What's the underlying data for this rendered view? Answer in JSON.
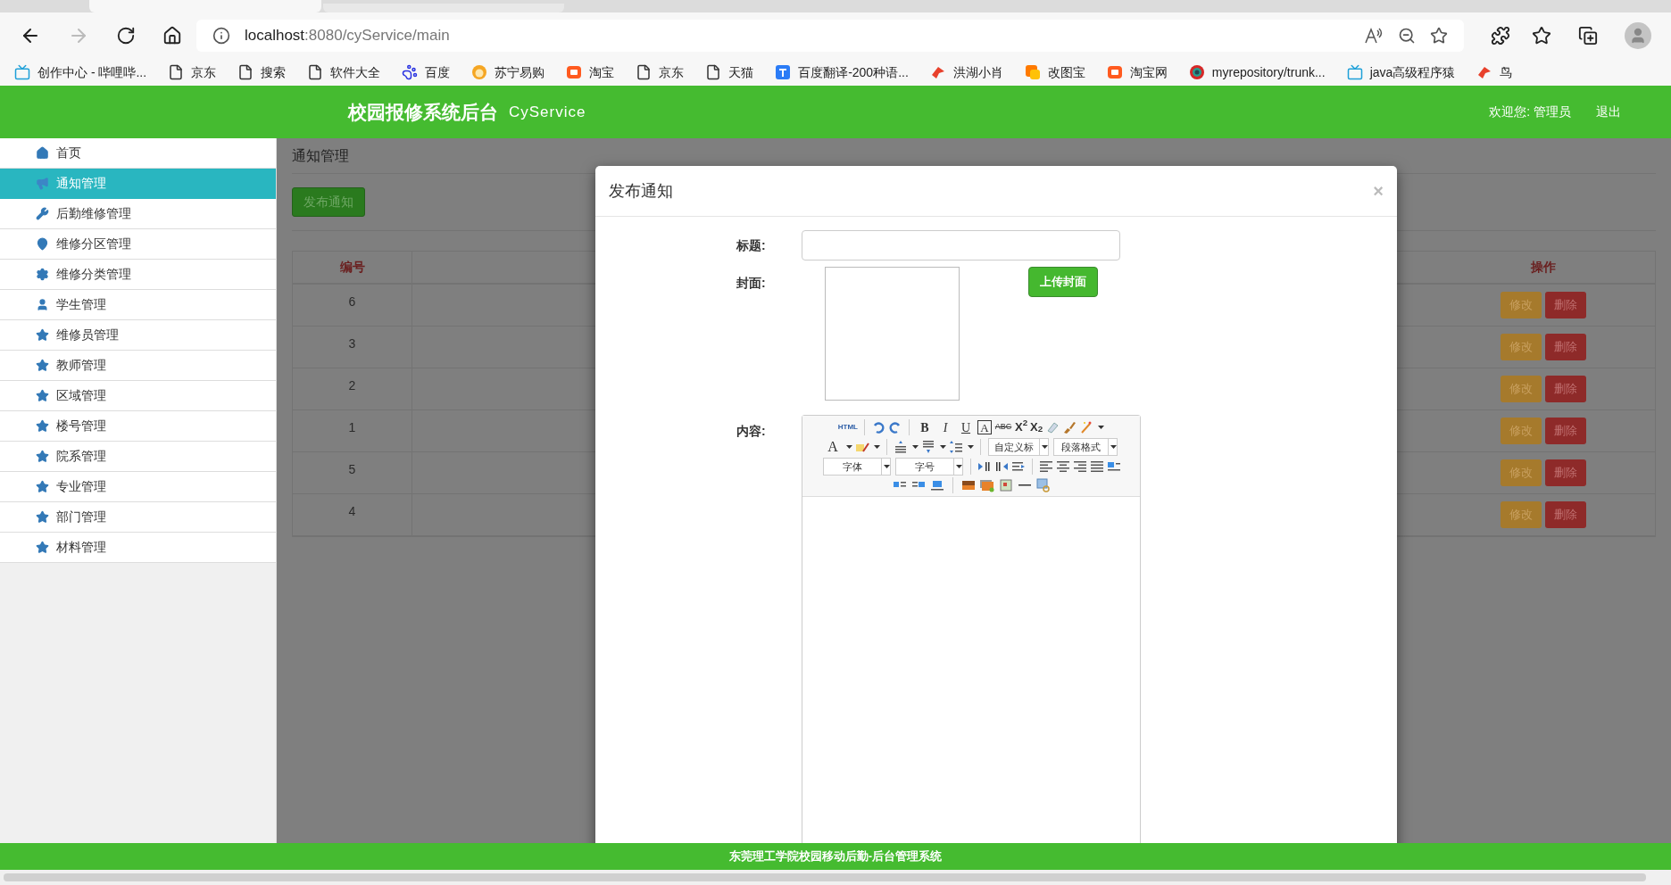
{
  "browser": {
    "url_host": "localhost",
    "url_rest": ":8080/cyService/main",
    "bookmarks": [
      "创作中心 - 哔哩哔...",
      "京东",
      "搜索",
      "软件大全",
      "百度",
      "苏宁易购",
      "淘宝",
      "京东",
      "天猫",
      "百度翻译-200种语...",
      "洪湖小肖",
      "改图宝",
      "淘宝网",
      "myrepository/trunk...",
      "java高级程序猿",
      "鸟"
    ]
  },
  "header": {
    "title": "校园报修系统后台",
    "subtitle": "CyService",
    "welcome": "欢迎您: 管理员",
    "logout": "退出"
  },
  "sidebar": {
    "items": [
      {
        "label": "首页",
        "selected": false
      },
      {
        "label": "通知管理",
        "selected": true
      },
      {
        "label": "后勤维修管理",
        "selected": false
      },
      {
        "label": "维修分区管理",
        "selected": false
      },
      {
        "label": "维修分类管理",
        "selected": false
      },
      {
        "label": "学生管理",
        "selected": false
      },
      {
        "label": "维修员管理",
        "selected": false
      },
      {
        "label": "教师管理",
        "selected": false
      },
      {
        "label": "区域管理",
        "selected": false
      },
      {
        "label": "楼号管理",
        "selected": false
      },
      {
        "label": "院系管理",
        "selected": false
      },
      {
        "label": "专业管理",
        "selected": false
      },
      {
        "label": "部门管理",
        "selected": false
      },
      {
        "label": "材料管理",
        "selected": false
      }
    ]
  },
  "page": {
    "breadcrumb": "通知管理",
    "publish_button": "发布通知",
    "table": {
      "columns": [
        "编号",
        "操作"
      ],
      "rows": [
        {
          "id": "6",
          "edit": "修改",
          "delete": "删除"
        },
        {
          "id": "3",
          "edit": "修改",
          "delete": "删除"
        },
        {
          "id": "2",
          "edit": "修改",
          "delete": "删除"
        },
        {
          "id": "1",
          "edit": "修改",
          "delete": "删除"
        },
        {
          "id": "5",
          "edit": "修改",
          "delete": "删除"
        },
        {
          "id": "4",
          "edit": "修改",
          "delete": "删除"
        }
      ]
    }
  },
  "modal": {
    "title": "发布通知",
    "close": "×",
    "title_label": "标题:",
    "cover_label": "封面:",
    "upload_button": "上传封面",
    "content_label": "内容:",
    "editor": {
      "html": "HTML",
      "bold": "B",
      "italic": "I",
      "underline": "U",
      "boxed": "A",
      "strike": "ABC",
      "superscript": "X$^{2}$",
      "subscript": "X$_{2}$",
      "font_color": "A",
      "heading_select": "自定义标",
      "paragraph_select": "段落格式",
      "font_select": "字体",
      "size_select": "字号"
    }
  },
  "footer": "东莞理工学院校园移动后勤-后台管理系统"
}
